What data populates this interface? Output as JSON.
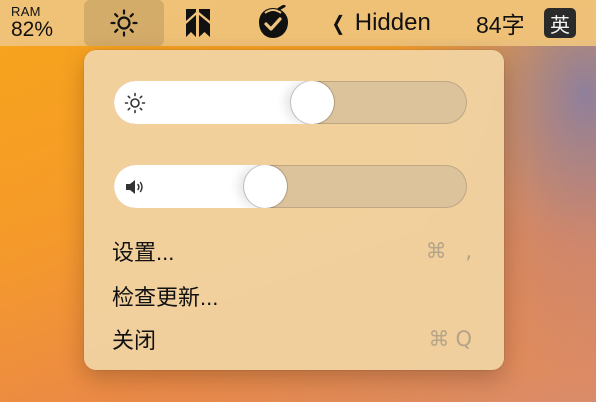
{
  "menubar": {
    "ram": {
      "label": "RAM",
      "value": "82%"
    },
    "brightness_icon": "sun-icon",
    "bookmark_icon": "bookmark-icon",
    "acorn_icon": "acorn-check-icon",
    "hidden_label": "Hidden",
    "hidden_chevron": "❮",
    "char_count": "84字",
    "input_method": "英"
  },
  "dropdown": {
    "brightness_slider": {
      "icon": "sun-icon",
      "level": 0.57
    },
    "volume_slider": {
      "icon": "speaker-icon",
      "level": 0.42
    },
    "items": [
      {
        "label": "设置...",
        "shortcut": "⌘ ,"
      },
      {
        "label": "检查更新...",
        "shortcut": ""
      },
      {
        "label": "关闭",
        "shortcut": "⌘Q"
      }
    ]
  },
  "colors": {
    "menubar_bg": "#eec47e",
    "dropdown_bg": "#f1d2a0",
    "slider_track": "#dcc39b",
    "shortcut_text": "#b5a488"
  }
}
